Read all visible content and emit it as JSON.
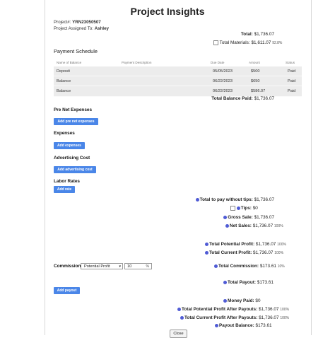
{
  "title": "Project Insights",
  "project": {
    "id_label": "Project#:",
    "id": "YRN23050507",
    "assigned_label": "Project Assigned To:",
    "assigned": "Ashley"
  },
  "totals": {
    "total_label": "Total:",
    "total": "$1,736.07",
    "materials_label": "Total Materials:",
    "materials": "$1,611.07",
    "materials_pct": "92.8%"
  },
  "payment_schedule": {
    "title": "Payment Schedule",
    "columns": [
      "Name of Balance",
      "Payment Description",
      "Due Date",
      "Amount",
      "Status"
    ],
    "rows": [
      {
        "name": "Deposit",
        "description": "",
        "due": "05/05/2023",
        "amount": "$500",
        "status": "Paid"
      },
      {
        "name": "Balance",
        "description": "",
        "due": "06/22/2023",
        "amount": "$650",
        "status": "Paid"
      },
      {
        "name": "Balance",
        "description": "",
        "due": "06/22/2023",
        "amount": "$586.07",
        "status": "Paid"
      }
    ],
    "total_paid_label": "Total Balance Paid:",
    "total_paid": "$1,736.07"
  },
  "sections": {
    "pre_net": {
      "title": "Pre Net Expenses",
      "button": "Add pre net expenses"
    },
    "expenses": {
      "title": "Expenses",
      "button": "Add expenses"
    },
    "advertising": {
      "title": "Advertising Cost",
      "button": "Add advertising cost"
    },
    "labor": {
      "title": "Labor Rates",
      "button": "Add rate"
    }
  },
  "summary": {
    "to_pay_label": "Total to pay without tips:",
    "to_pay": "$1,736.07",
    "tips_label": "Tips:",
    "tips": "$0",
    "gross_label": "Gross Sale:",
    "gross": "$1,736.07",
    "net_label": "Net Sales:",
    "net": "$1,736.07",
    "net_pct": "100%",
    "potential_label": "Total Potential Profit:",
    "potential": "$1,736.07",
    "potential_pct": "100%",
    "current_label": "Total Current Profit:",
    "current": "$1,736.07",
    "current_pct": "100%"
  },
  "commission": {
    "label": "Commission:",
    "type": "Potential Profit",
    "value": "10",
    "unit": "%",
    "total_label": "Total Commission:",
    "total": "$173.61",
    "total_pct": "10%"
  },
  "payout": {
    "total_label": "Total Payout:",
    "total": "$173.61",
    "button": "Add payout",
    "money_paid_label": "Money Paid:",
    "money_paid": "$0",
    "potential_after_label": "Total Potential Profit After Payouts:",
    "potential_after": "$1,736.07",
    "potential_after_pct": "100%",
    "current_after_label": "Total Current Profit After Payouts:",
    "current_after": "$1,736.07",
    "current_after_pct": "100%",
    "balance_label": "Payout Balance:",
    "balance": "$173.61"
  },
  "close_label": "Close",
  "colors": {
    "button": "#4a86e8",
    "info_dot": "#4f5bd5",
    "row_bg": "#ececec"
  }
}
